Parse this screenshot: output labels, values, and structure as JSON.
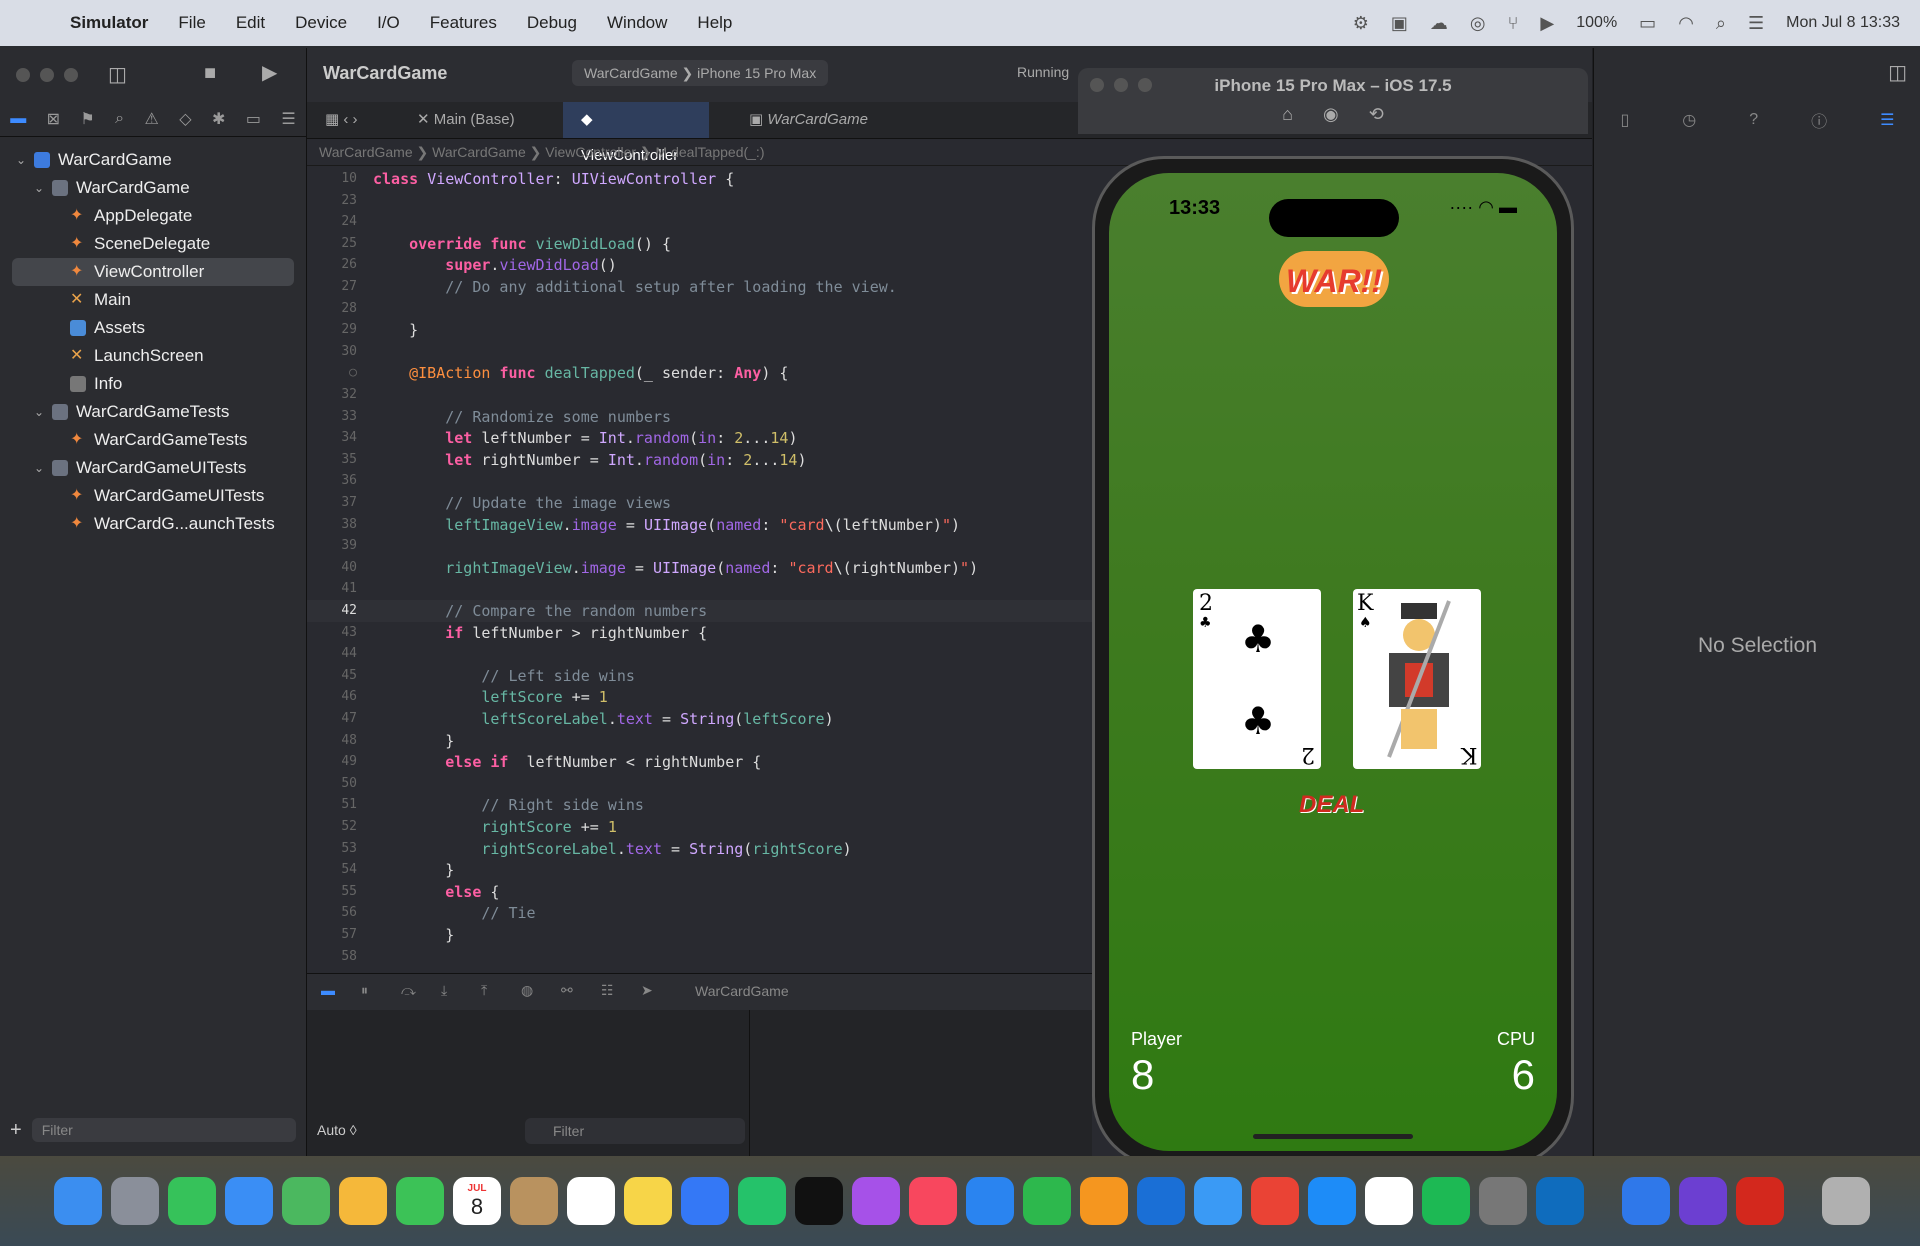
{
  "menubar": {
    "app": "Simulator",
    "items": [
      "File",
      "Edit",
      "Device",
      "I/O",
      "Features",
      "Debug",
      "Window",
      "Help"
    ],
    "battery": "100%",
    "datetime": "Mon Jul 8  13:33"
  },
  "xcode": {
    "project_title": "WarCardGame",
    "scheme": "WarCardGame ❯  iPhone 15 Pro Max",
    "status": "Running",
    "tabs": [
      "Main (Base)",
      "ViewController",
      "WarCardGame"
    ],
    "breadcrumb": "WarCardGame ❯  WarCardGame ❯  ViewController ❯  M  dealTapped(_:)",
    "tree": [
      {
        "label": "WarCardGame",
        "indent": 0,
        "type": "proj",
        "chev": "⌄"
      },
      {
        "label": "WarCardGame",
        "indent": 1,
        "type": "folder",
        "chev": "⌄"
      },
      {
        "label": "AppDelegate",
        "indent": 2,
        "type": "swift"
      },
      {
        "label": "SceneDelegate",
        "indent": 2,
        "type": "swift"
      },
      {
        "label": "ViewController",
        "indent": 2,
        "type": "swift",
        "selected": true
      },
      {
        "label": "Main",
        "indent": 2,
        "type": "xib"
      },
      {
        "label": "Assets",
        "indent": 2,
        "type": "assets"
      },
      {
        "label": "LaunchScreen",
        "indent": 2,
        "type": "xib"
      },
      {
        "label": "Info",
        "indent": 2,
        "type": "plist"
      },
      {
        "label": "WarCardGameTests",
        "indent": 1,
        "type": "folder",
        "chev": "⌄"
      },
      {
        "label": "WarCardGameTests",
        "indent": 2,
        "type": "swift"
      },
      {
        "label": "WarCardGameUITests",
        "indent": 1,
        "type": "folder",
        "chev": "⌄"
      },
      {
        "label": "WarCardGameUITests",
        "indent": 2,
        "type": "swift"
      },
      {
        "label": "WarCardG...aunchTests",
        "indent": 2,
        "type": "swift"
      }
    ],
    "filter_placeholder": "Filter",
    "console_auto": "Auto ◊",
    "console_filter": "Filter",
    "debug_target": "WarCardGame",
    "inspector_empty": "No Selection",
    "current_line": "42",
    "code": [
      {
        "n": "10",
        "h": "<span class='kw'>class</span> <span class='ty'>ViewController</span>: <span class='ty'>UIViewController</span> {"
      },
      {
        "n": "23",
        "h": ""
      },
      {
        "n": "24",
        "h": ""
      },
      {
        "n": "25",
        "h": "    <span class='kw'>override</span> <span class='kw'>func</span> <span class='fn'>viewDidLoad</span>() {"
      },
      {
        "n": "26",
        "h": "        <span class='kw'>super</span>.<span class='pr'>viewDidLoad</span>()"
      },
      {
        "n": "27",
        "h": "        <span class='cm'>// Do any additional setup after loading the view.</span>"
      },
      {
        "n": "28",
        "h": ""
      },
      {
        "n": "29",
        "h": "    }"
      },
      {
        "n": "30",
        "h": ""
      },
      {
        "n": "○",
        "h": "    <span class='at'>@IBAction</span> <span class='kw'>func</span> <span class='fn'>dealTapped</span>(_ sender: <span class='kw'>Any</span>) {"
      },
      {
        "n": "32",
        "h": ""
      },
      {
        "n": "33",
        "h": "        <span class='cm'>// Randomize some numbers</span>"
      },
      {
        "n": "34",
        "h": "        <span class='kw'>let</span> leftNumber = <span class='ty'>Int</span>.<span class='pr'>random</span>(<span class='pr'>in</span>: <span class='num'>2</span>...<span class='num'>14</span>)"
      },
      {
        "n": "35",
        "h": "        <span class='kw'>let</span> rightNumber = <span class='ty'>Int</span>.<span class='pr'>random</span>(<span class='pr'>in</span>: <span class='num'>2</span>...<span class='num'>14</span>)"
      },
      {
        "n": "36",
        "h": ""
      },
      {
        "n": "37",
        "h": "        <span class='cm'>// Update the image views</span>"
      },
      {
        "n": "38",
        "h": "        <span class='fn'>leftImageView</span>.<span class='pr'>image</span> = <span class='ty'>UIImage</span>(<span class='pr'>named</span>: <span class='str'>\"card</span>\\(leftNumber)<span class='str'>\"</span>)"
      },
      {
        "n": "39",
        "h": ""
      },
      {
        "n": "40",
        "h": "        <span class='fn'>rightImageView</span>.<span class='pr'>image</span> = <span class='ty'>UIImage</span>(<span class='pr'>named</span>: <span class='str'>\"card</span>\\(rightNumber)<span class='str'>\"</span>)"
      },
      {
        "n": "41",
        "h": ""
      },
      {
        "n": "42",
        "h": "        <span class='cm'>// Compare the random numbers</span>"
      },
      {
        "n": "43",
        "h": "        <span class='kw'>if</span> leftNumber &gt; rightNumber {"
      },
      {
        "n": "44",
        "h": ""
      },
      {
        "n": "45",
        "h": "            <span class='cm'>// Left side wins</span>"
      },
      {
        "n": "46",
        "h": "            <span class='fn'>leftScore</span> += <span class='num'>1</span>"
      },
      {
        "n": "47",
        "h": "            <span class='fn'>leftScoreLabel</span>.<span class='pr'>text</span> = <span class='ty'>String</span>(<span class='fn'>leftScore</span>)"
      },
      {
        "n": "48",
        "h": "        }"
      },
      {
        "n": "49",
        "h": "        <span class='kw'>else if</span>  leftNumber &lt; rightNumber {"
      },
      {
        "n": "50",
        "h": ""
      },
      {
        "n": "51",
        "h": "            <span class='cm'>// Right side wins</span>"
      },
      {
        "n": "52",
        "h": "            <span class='fn'>rightScore</span> += <span class='num'>1</span>"
      },
      {
        "n": "53",
        "h": "            <span class='fn'>rightScoreLabel</span>.<span class='pr'>text</span> = <span class='ty'>String</span>(<span class='fn'>rightScore</span>)"
      },
      {
        "n": "54",
        "h": "        }"
      },
      {
        "n": "55",
        "h": "        <span class='kw'>else</span> {"
      },
      {
        "n": "56",
        "h": "            <span class='cm'>// Tie</span>"
      },
      {
        "n": "57",
        "h": "        }"
      },
      {
        "n": "58",
        "h": ""
      }
    ]
  },
  "simulator": {
    "window_title": "iPhone 15 Pro Max – iOS 17.5",
    "time": "13:33",
    "logo_text": "WAR!!",
    "left_card": {
      "rank": "2",
      "suit": "♣"
    },
    "right_card": {
      "rank": "K",
      "suit": "♠"
    },
    "deal_label": "DEAL",
    "player_label": "Player",
    "player_score": "8",
    "cpu_label": "CPU",
    "cpu_score": "6"
  },
  "colors": {
    "accent": "#3d8bff",
    "felt": "#3e7a1f",
    "deal": "#d02a1f"
  },
  "dock": [
    "Finder",
    "Launchpad",
    "Messages",
    "Mail",
    "Maps",
    "Photos",
    "FaceTime",
    "Calendar",
    "Contacts",
    "Reminders",
    "Notes",
    "Xcode",
    "PyCharm",
    "TV",
    "Podcasts",
    "Music",
    "Keynote",
    "Numbers",
    "Pages",
    "OneDrive",
    "Safari",
    "Chrome",
    "App Store",
    "ChatGPT",
    "Spotify",
    "System Settings",
    "Outlook",
    "Xcode Beta",
    "iMovie",
    "Acrobat",
    "Trash"
  ],
  "dock_calendar": {
    "month": "JUL",
    "day": "8"
  }
}
